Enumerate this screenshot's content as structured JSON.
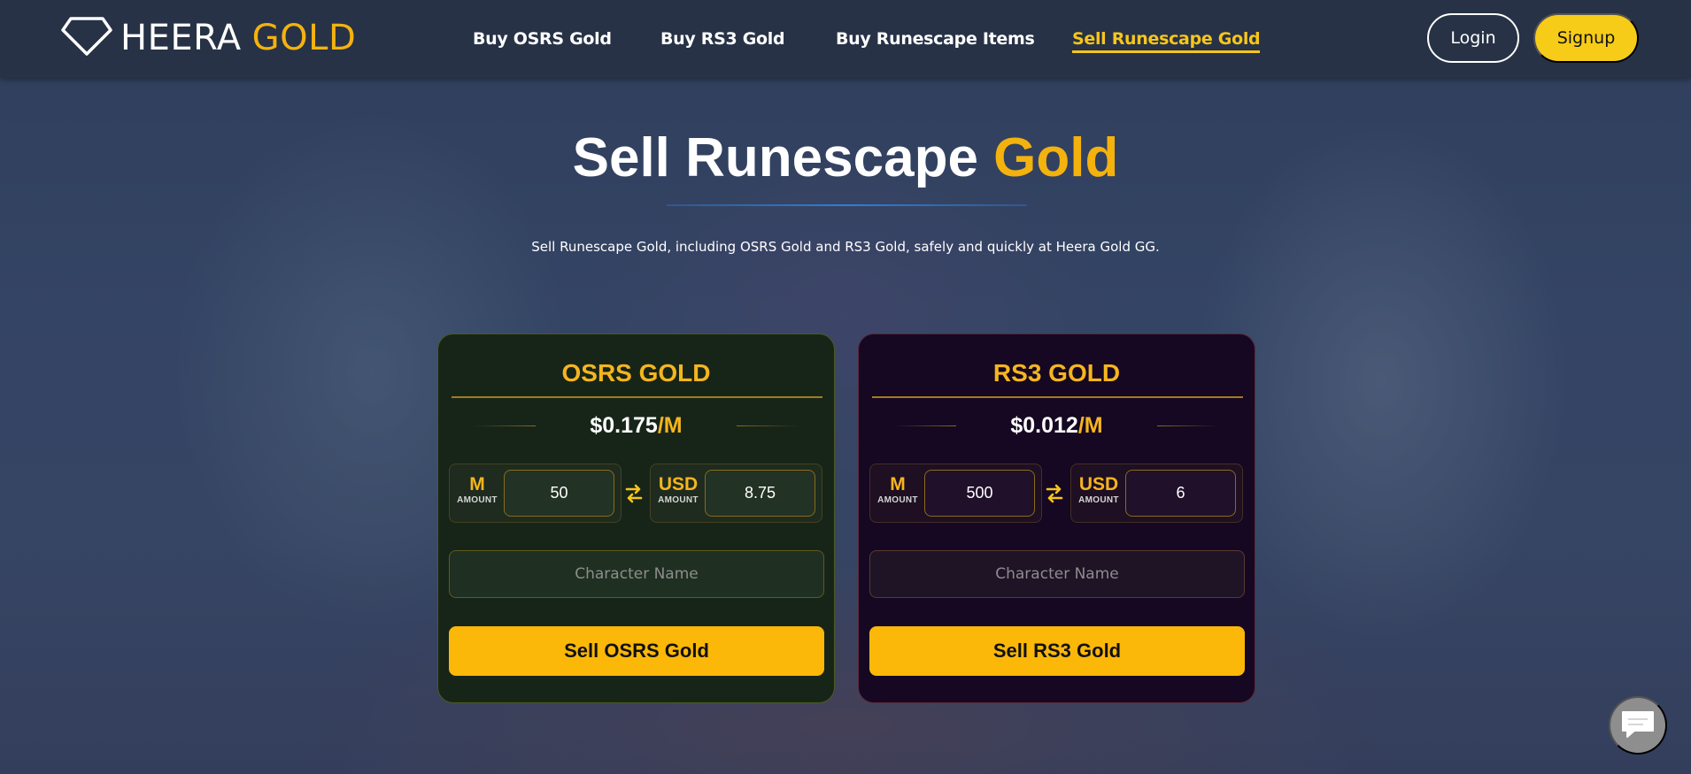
{
  "brand": {
    "name_part1": "HEERA",
    "name_part2": "GOLD",
    "accent_color": "#f4b20f"
  },
  "nav": {
    "items": [
      {
        "label": "Buy OSRS Gold"
      },
      {
        "label": "Buy RS3 Gold"
      },
      {
        "label": "Buy Runescape Items"
      },
      {
        "label": "Sell Runescape Gold",
        "active": true
      }
    ],
    "login_label": "Login",
    "signup_label": "Signup"
  },
  "hero": {
    "title_main": "Sell Runescape",
    "title_accent": "Gold",
    "subtitle": "Sell Runescape Gold, including OSRS Gold and RS3 Gold, safely and quickly at Heera Gold GG."
  },
  "cards": [
    {
      "title": "OSRS GOLD",
      "price": "$0.175",
      "price_unit": "/M",
      "left_unit": "M",
      "left_caption": "AMOUNT",
      "left_value": "50",
      "right_unit": "USD",
      "right_caption": "AMOUNT",
      "right_value": "8.75",
      "name_placeholder": "Character Name",
      "button_label": "Sell OSRS Gold"
    },
    {
      "title": "RS3 GOLD",
      "price": "$0.012",
      "price_unit": "/M",
      "left_unit": "M",
      "left_caption": "AMOUNT",
      "left_value": "500",
      "right_unit": "USD",
      "right_caption": "AMOUNT",
      "right_value": "6",
      "name_placeholder": "Character Name",
      "button_label": "Sell RS3 Gold"
    }
  ],
  "icons": {
    "logo": "diamond-icon",
    "swap": "swap-arrows-icon",
    "chat": "chat-bubble-icon"
  },
  "colors": {
    "header_bg": "#273246",
    "gold": "#f5b51e",
    "button_yellow": "#fbb808",
    "signup_yellow": "#f7cc18",
    "osrs_card_bg": "#172519",
    "rs3_card_bg": "#160822"
  }
}
